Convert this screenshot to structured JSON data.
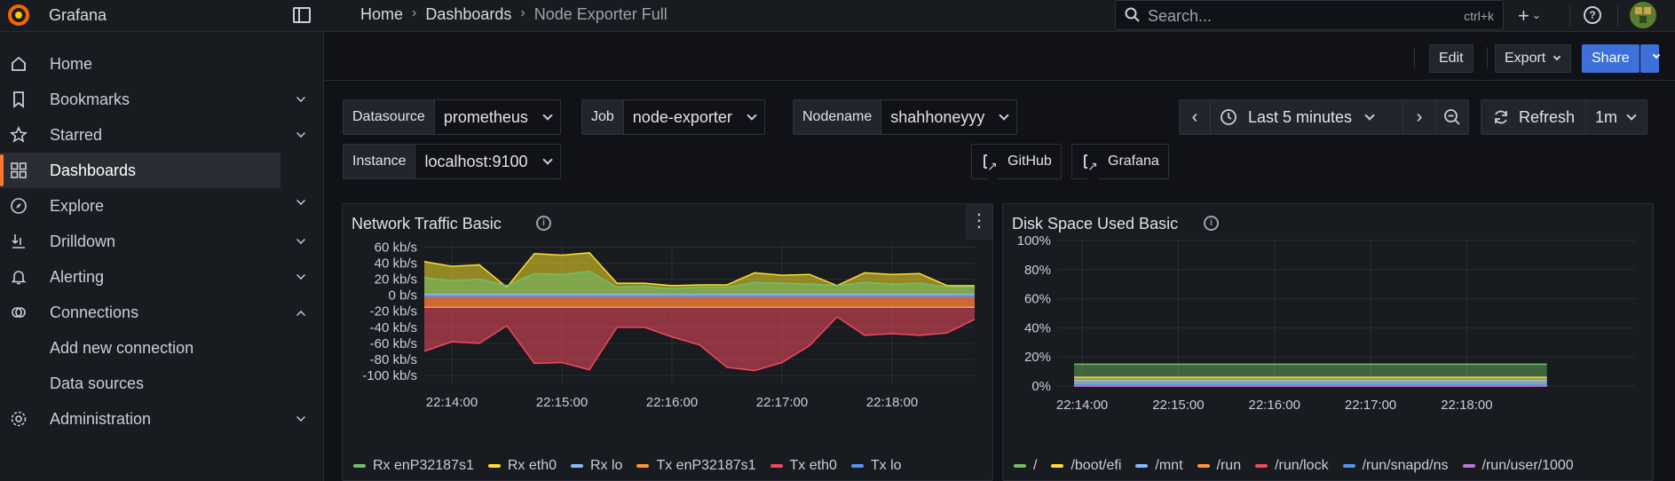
{
  "app": {
    "brand": "Grafana"
  },
  "breadcrumb": [
    "Home",
    "Dashboards",
    "Node Exporter Full"
  ],
  "search": {
    "placeholder": "Search...",
    "shortcut": "ctrl+k"
  },
  "toolbar": {
    "edit": "Edit",
    "export": "Export",
    "share": "Share"
  },
  "sidebar": {
    "items": [
      {
        "label": "Home",
        "icon": "home-icon",
        "chevron": ""
      },
      {
        "label": "Bookmarks",
        "icon": "bookmark-icon",
        "chevron": "down"
      },
      {
        "label": "Starred",
        "icon": "star-icon",
        "chevron": "down"
      },
      {
        "label": "Dashboards",
        "icon": "apps-icon",
        "chevron": "down",
        "active": true
      },
      {
        "label": "Explore",
        "icon": "compass-icon",
        "chevron": ""
      },
      {
        "label": "Drilldown",
        "icon": "drilldown-icon",
        "chevron": "down"
      },
      {
        "label": "Alerting",
        "icon": "bell-icon",
        "chevron": "down"
      },
      {
        "label": "Connections",
        "icon": "link-icon",
        "chevron": "up"
      },
      {
        "label": "Add new connection",
        "icon": "",
        "chevron": "",
        "sub": true
      },
      {
        "label": "Data sources",
        "icon": "",
        "chevron": "",
        "sub": true
      },
      {
        "label": "Administration",
        "icon": "gear-icon",
        "chevron": "down"
      }
    ]
  },
  "variables": {
    "datasource": {
      "label": "Datasource",
      "value": "prometheus"
    },
    "job": {
      "label": "Job",
      "value": "node-exporter"
    },
    "nodename": {
      "label": "Nodename",
      "value": "shahhoneyyy"
    },
    "instance": {
      "label": "Instance",
      "value": "localhost:9100"
    }
  },
  "links": {
    "github": "GitHub",
    "grafana": "Grafana"
  },
  "timepicker": {
    "range": "Last 5 minutes",
    "refresh": "Refresh",
    "interval": "1m"
  },
  "colors": {
    "green": "#73bf69",
    "yellow": "#fade2a",
    "lightblue": "#8ab8ff",
    "orange": "#ff9830",
    "red": "#f2495c",
    "blue": "#5794f2",
    "purple": "#b877d9",
    "accent": "#ff7a2e",
    "primary": "#3d71d9"
  },
  "panels": [
    {
      "title": "Network Traffic Basic",
      "legend": [
        {
          "name": "Rx enP32187s1",
          "color": "#73bf69"
        },
        {
          "name": "Rx eth0",
          "color": "#fade2a"
        },
        {
          "name": "Rx lo",
          "color": "#8ab8ff"
        },
        {
          "name": "Tx enP32187s1",
          "color": "#ff9830"
        },
        {
          "name": "Tx eth0",
          "color": "#f2495c"
        },
        {
          "name": "Tx lo",
          "color": "#5794f2"
        }
      ]
    },
    {
      "title": "Disk Space Used Basic",
      "legend": [
        {
          "name": "/",
          "color": "#73bf69"
        },
        {
          "name": "/boot/efi",
          "color": "#fade2a"
        },
        {
          "name": "/mnt",
          "color": "#8ab8ff"
        },
        {
          "name": "/run",
          "color": "#ff9830"
        },
        {
          "name": "/run/lock",
          "color": "#f2495c"
        },
        {
          "name": "/run/snapd/ns",
          "color": "#5794f2"
        },
        {
          "name": "/run/user/1000",
          "color": "#b877d9"
        }
      ]
    }
  ],
  "chart_data": [
    {
      "type": "area",
      "x": [
        "22:13:45",
        "22:14:00",
        "22:14:15",
        "22:14:30",
        "22:14:45",
        "22:15:00",
        "22:15:15",
        "22:15:30",
        "22:15:45",
        "22:16:00",
        "22:16:15",
        "22:16:30",
        "22:16:45",
        "22:17:00",
        "22:17:15",
        "22:17:30",
        "22:17:45",
        "22:18:00",
        "22:18:15",
        "22:18:30",
        "22:18:45"
      ],
      "xticks": [
        "22:14:00",
        "22:15:00",
        "22:16:00",
        "22:17:00",
        "22:18:00"
      ],
      "yticks": [
        "60 kb/s",
        "40 kb/s",
        "20 kb/s",
        "0 b/s",
        "-20 kb/s",
        "-40 kb/s",
        "-60 kb/s",
        "-80 kb/s",
        "-100 kb/s"
      ],
      "ylim": [
        -110,
        65
      ],
      "series": [
        {
          "name": "Rx enP32187s1",
          "values": [
            22,
            18,
            20,
            12,
            27,
            26,
            30,
            10,
            11,
            8,
            10,
            10,
            16,
            15,
            14,
            12,
            16,
            14,
            15,
            10,
            10
          ]
        },
        {
          "name": "Rx eth0",
          "values": [
            42,
            36,
            38,
            10,
            52,
            50,
            53,
            15,
            15,
            12,
            13,
            13,
            28,
            25,
            26,
            12,
            28,
            26,
            27,
            12,
            12
          ]
        },
        {
          "name": "Rx lo",
          "values": [
            1,
            1,
            1,
            1,
            1,
            1,
            1,
            1,
            1,
            1,
            1,
            1,
            1,
            1,
            1,
            1,
            1,
            1,
            1,
            1,
            1
          ]
        },
        {
          "name": "Tx enP32187s1",
          "values": [
            -15,
            -15,
            -15,
            -15,
            -15,
            -15,
            -15,
            -15,
            -15,
            -15,
            -15,
            -15,
            -15,
            -15,
            -15,
            -15,
            -15,
            -15,
            -15,
            -15,
            -15
          ]
        },
        {
          "name": "Tx eth0",
          "values": [
            -70,
            -58,
            -60,
            -38,
            -85,
            -84,
            -93,
            -40,
            -40,
            -52,
            -62,
            -90,
            -94,
            -84,
            -63,
            -27,
            -50,
            -48,
            -50,
            -47,
            -30
          ]
        },
        {
          "name": "Tx lo",
          "values": [
            -1,
            -1,
            -1,
            -1,
            -1,
            -1,
            -1,
            -1,
            -1,
            -1,
            -1,
            -1,
            -1,
            -1,
            -1,
            -1,
            -1,
            -1,
            -1,
            -1,
            -1
          ]
        }
      ]
    },
    {
      "type": "area",
      "x": [
        "22:13:55",
        "22:18:50"
      ],
      "xticks": [
        "22:14:00",
        "22:15:00",
        "22:16:00",
        "22:17:00",
        "22:18:00"
      ],
      "yticks": [
        "100%",
        "80%",
        "60%",
        "40%",
        "20%",
        "0%"
      ],
      "ylim": [
        0,
        100
      ],
      "series": [
        {
          "name": "/",
          "values": [
            15,
            15
          ]
        },
        {
          "name": "/boot/efi",
          "values": [
            6,
            6
          ]
        },
        {
          "name": "/mnt",
          "values": [
            4,
            4
          ]
        },
        {
          "name": "/run",
          "values": [
            1,
            1
          ]
        },
        {
          "name": "/run/lock",
          "values": [
            0,
            0
          ]
        },
        {
          "name": "/run/snapd/ns",
          "values": [
            1,
            1
          ]
        },
        {
          "name": "/run/user/1000",
          "values": [
            0,
            0
          ]
        }
      ]
    }
  ]
}
